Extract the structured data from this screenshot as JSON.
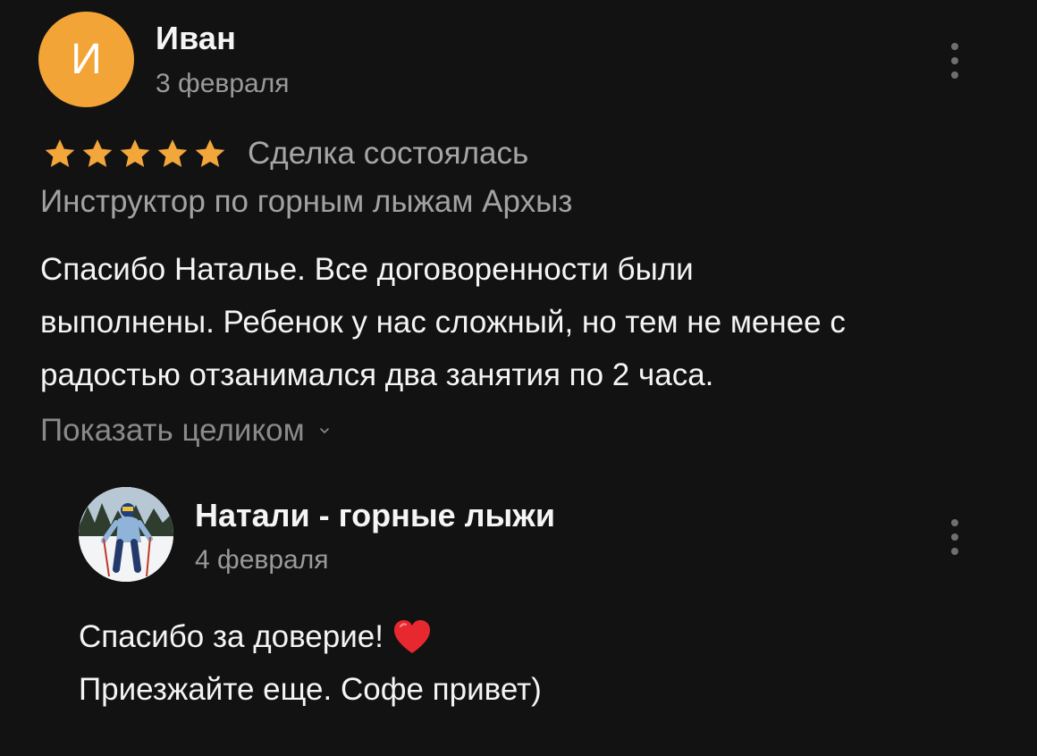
{
  "review": {
    "avatar_letter": "И",
    "author": "Иван",
    "date": "3 февраля",
    "rating": 5,
    "rating_max": 5,
    "deal_status": "Сделка состоялась",
    "service": "Инструктор по горным лыжам Архыз",
    "text_lines": [
      "Спасибо Наталье. Все договоренности были",
      "выполнены. Ребенок у нас сложный, но тем не менее с",
      "радостью отзанимался два занятия по 2 часа."
    ],
    "show_full_label": "Показать целиком",
    "avatar_color": "#f2a437",
    "star_color": "#f3a63a"
  },
  "reply": {
    "author": "Натали - горные лыжи",
    "date": "4 февраля",
    "line1": "Спасибо за доверие!",
    "line2": "Приезжайте еще.  Софе привет)",
    "heart_color": "#e8282f"
  }
}
